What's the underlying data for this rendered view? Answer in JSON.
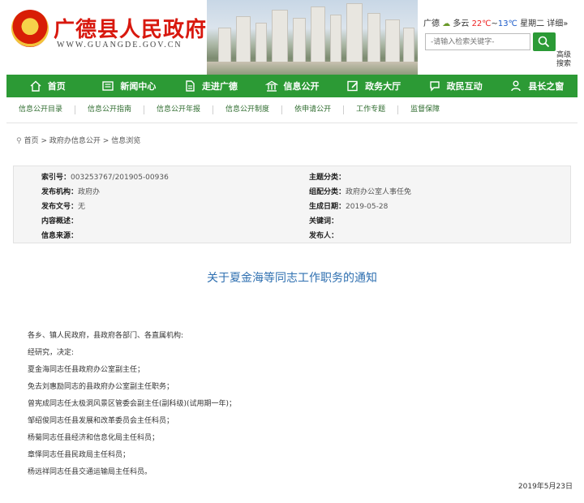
{
  "header": {
    "title": "广德县人民政府",
    "domain": "WWW.GUANGDE.GOV.CN",
    "weather": {
      "city": "广德",
      "condition": "多云",
      "high": "22℃",
      "separator": "~",
      "low": "13℃",
      "weekday": "星期二",
      "detail": "详细»"
    },
    "search": {
      "placeholder": "-请输入检索关键字-",
      "advanced": "高级搜索"
    }
  },
  "main_nav": [
    {
      "label": "首页",
      "icon": "home-icon"
    },
    {
      "label": "新闻中心",
      "icon": "newspaper-icon"
    },
    {
      "label": "走进广德",
      "icon": "document-icon"
    },
    {
      "label": "信息公开",
      "icon": "bank-icon"
    },
    {
      "label": "政务大厅",
      "icon": "edit-icon"
    },
    {
      "label": "政民互动",
      "icon": "chat-icon"
    },
    {
      "label": "县长之窗",
      "icon": "person-icon"
    }
  ],
  "sub_nav": [
    "信息公开目录",
    "信息公开指南",
    "信息公开年报",
    "信息公开制度",
    "依申请公开",
    "工作专题",
    "监督保障"
  ],
  "breadcrumb": {
    "home": "首页",
    "sep1": ">",
    "section": "政府办信息公开",
    "sep2": ">",
    "current": "信息浏览"
  },
  "info": {
    "index_no": {
      "label": "索引号：",
      "value": "003253767/201905-00936"
    },
    "subject": {
      "label": "主题分类：",
      "value": ""
    },
    "publisher_org": {
      "label": "发布机构：",
      "value": "政府办"
    },
    "org_category": {
      "label": "组配分类：",
      "value": "政府办公室人事任免"
    },
    "doc_no": {
      "label": "发布文号：",
      "value": "无"
    },
    "created": {
      "label": "生成日期：",
      "value": "2019-05-28"
    },
    "summary": {
      "label": "内容概述：",
      "value": ""
    },
    "keywords": {
      "label": "关键词：",
      "value": ""
    },
    "source": {
      "label": "信息来源：",
      "value": ""
    },
    "publisher": {
      "label": "发布人：",
      "value": ""
    }
  },
  "article": {
    "title": "关于夏金海等同志工作职务的通知",
    "paragraphs": [
      "各乡、镇人民政府，县政府各部门、各直属机构:",
      "经研究，决定:",
      "夏金海同志任县政府办公室副主任；",
      "免去刘惠励同志的县政府办公室副主任职务；",
      "曾宪成同志任太极洞风景区管委会副主任(副科级)(试用期一年)；",
      "邹绍俊同志任县发展和改革委员会主任科员；",
      "杨菊同志任县经济和信息化局主任科员；",
      "章怿同志任县民政局主任科员；",
      "杨远祥同志任县交通运输局主任科员。"
    ],
    "date": "2019年5月23日"
  },
  "colors": {
    "brand_red": "#d8180e",
    "nav_green": "#2c9a35",
    "title_blue": "#2e6fb0"
  }
}
